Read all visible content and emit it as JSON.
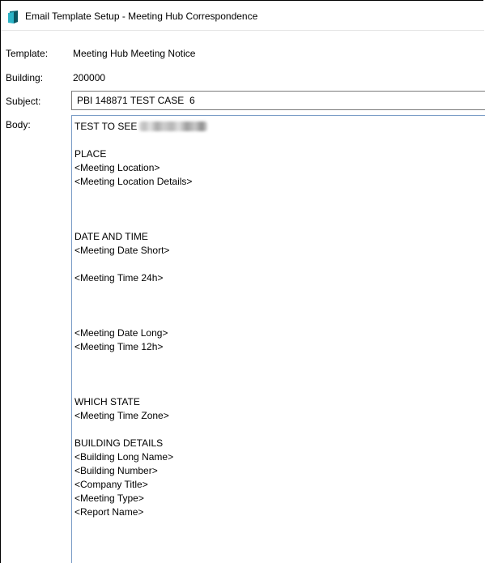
{
  "window": {
    "title": "Email Template Setup - Meeting Hub Correspondence",
    "icon": "document-icon"
  },
  "form": {
    "template_label": "Template:",
    "template_value": "Meeting Hub Meeting Notice",
    "building_label": "Building:",
    "building_value": "200000",
    "subject_label": "Subject:",
    "subject_value": "PBI 148871 TEST CASE  6",
    "body_label": "Body:"
  },
  "body": {
    "first_line": "TEST TO SEE",
    "lines": [
      "",
      "PLACE",
      "<Meeting Location>",
      "<Meeting Location Details>",
      "",
      "",
      "",
      "DATE AND TIME",
      "<Meeting Date Short>",
      "",
      "<Meeting Time 24h>",
      "",
      "",
      "",
      "<Meeting Date Long>",
      "<Meeting Time 12h>",
      "",
      "",
      "",
      "WHICH STATE",
      "<Meeting Time Zone>",
      "",
      "BUILDING  DETAILS",
      "<Building Long Name>",
      "<Building Number>",
      "<Company Title>",
      "<Meeting Type>",
      "<Report Name>"
    ]
  }
}
